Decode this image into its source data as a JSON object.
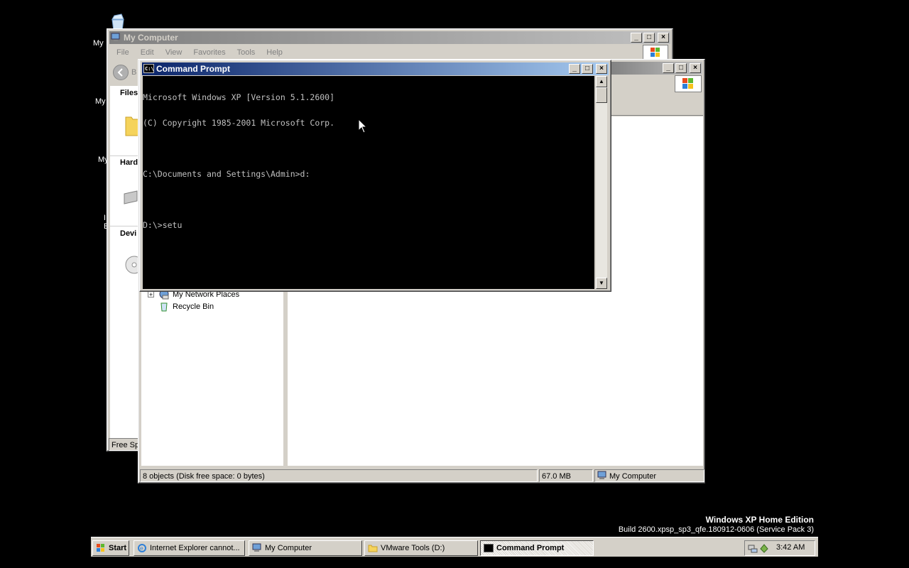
{
  "desktop": {
    "partial_labels": [
      "My",
      "My",
      "My",
      "I",
      "E"
    ],
    "os_edition": "Windows XP Home Edition",
    "build": "Build 2600.xpsp_sp3_qfe.180912-0606 (Service Pack 3)"
  },
  "mycomputer_back": {
    "title": "My Computer",
    "menu": [
      "File",
      "Edit",
      "View",
      "Favorites",
      "Tools",
      "Help"
    ],
    "back_label": "B",
    "sections": [
      "Files",
      "Hard",
      "Devi"
    ],
    "status": "Free Spa"
  },
  "mycomputer_front": {
    "tree": [
      "My Network Places",
      "Recycle Bin"
    ],
    "tree_expander": "+",
    "status": {
      "objects": "8 objects (Disk free space: 0 bytes)",
      "size": "67.0 MB",
      "location": "My Computer"
    }
  },
  "cmd": {
    "title": "Command Prompt",
    "lines": [
      "Microsoft Windows XP [Version 5.1.2600]",
      "(C) Copyright 1985-2001 Microsoft Corp.",
      "",
      "C:\\Documents and Settings\\Admin>d:",
      "",
      "D:\\>setu"
    ]
  },
  "taskbar": {
    "start_label": "Start",
    "tasks": [
      {
        "label": "Internet Explorer cannot...",
        "icon": "ie-icon"
      },
      {
        "label": "My Computer",
        "icon": "computer-icon"
      },
      {
        "label": "VMware Tools (D:)",
        "icon": "folder-icon"
      },
      {
        "label": "Command Prompt",
        "icon": "cmd-icon",
        "active": true
      }
    ],
    "clock": "3:42 AM"
  }
}
